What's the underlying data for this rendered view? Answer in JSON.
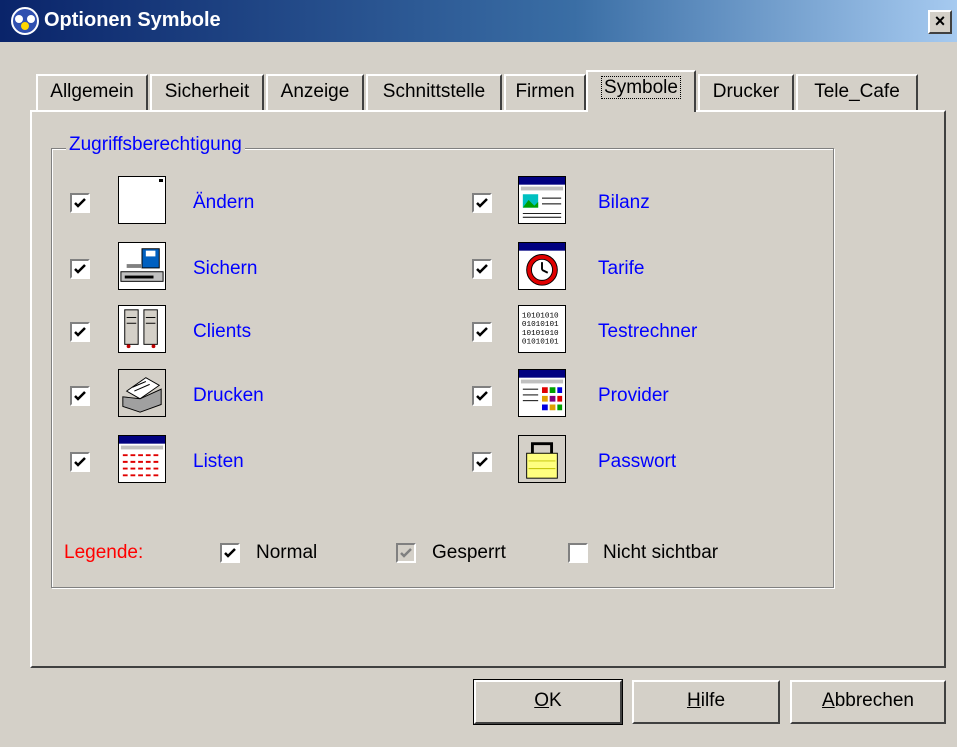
{
  "window": {
    "title": "Optionen Symbole",
    "close_label": "×"
  },
  "tabs": [
    {
      "label": "Allgemein"
    },
    {
      "label": "Sicherheit"
    },
    {
      "label": "Anzeige"
    },
    {
      "label": "Schnittstelle"
    },
    {
      "label": "Firmen"
    },
    {
      "label": "Symbole",
      "active": true
    },
    {
      "label": "Drucker"
    },
    {
      "label": "Tele_Cafe"
    }
  ],
  "group": {
    "label": "Zugriffsberechtigung",
    "left_items": [
      {
        "label": "Ändern",
        "checked": true,
        "icon": "blank-page-icon"
      },
      {
        "label": "Sichern",
        "checked": true,
        "icon": "backup-drive-icon"
      },
      {
        "label": "Clients",
        "checked": true,
        "icon": "clients-icon"
      },
      {
        "label": "Drucken",
        "checked": true,
        "icon": "printer-icon"
      },
      {
        "label": "Listen",
        "checked": true,
        "icon": "list-icon"
      }
    ],
    "right_items": [
      {
        "label": "Bilanz",
        "checked": true,
        "icon": "balance-icon"
      },
      {
        "label": "Tarife",
        "checked": true,
        "icon": "clock-icon"
      },
      {
        "label": "Testrechner",
        "checked": true,
        "icon": "binary-icon"
      },
      {
        "label": "Provider",
        "checked": true,
        "icon": "provider-icon"
      },
      {
        "label": "Passwort",
        "checked": true,
        "icon": "lock-icon"
      }
    ]
  },
  "legend": {
    "title": "Legende:",
    "normal": "Normal",
    "locked": "Gesperrt",
    "hidden": "Nicht sichtbar"
  },
  "buttons": {
    "ok_mnemonic": "O",
    "ok_rest": "K",
    "help_mnemonic": "H",
    "help_rest": "ilfe",
    "cancel_mnemonic": "A",
    "cancel_rest": "bbrechen"
  },
  "colors": {
    "accent": "#0000ff",
    "legend": "#ff0000",
    "titlebar": "#0a246a"
  }
}
